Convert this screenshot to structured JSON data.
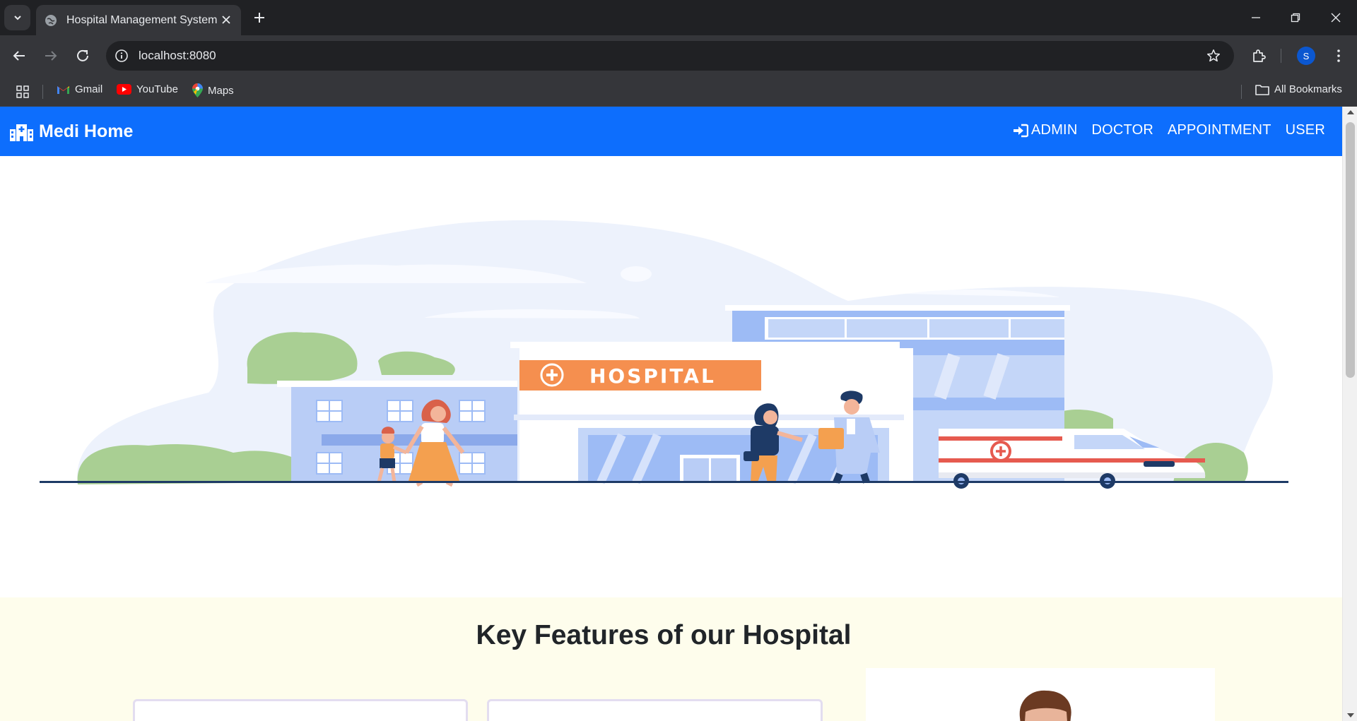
{
  "browser": {
    "tab_title": "Hospital Management System",
    "url": "localhost:8080",
    "profile_initial": "S",
    "bookmarks": [
      "Gmail",
      "YouTube",
      "Maps"
    ],
    "all_bookmarks": "All Bookmarks"
  },
  "navbar": {
    "brand": "Medi Home",
    "links": [
      "ADMIN",
      "DOCTOR",
      "APPOINTMENT",
      "USER"
    ]
  },
  "hero": {
    "sign_text": "HOSPITAL"
  },
  "features": {
    "title": "Key Features of our Hospital"
  },
  "colors": {
    "navbar": "#0d6efd",
    "features_bg": "#fefdec",
    "building": "#9dbbf5",
    "sign": "#f58f4f"
  }
}
